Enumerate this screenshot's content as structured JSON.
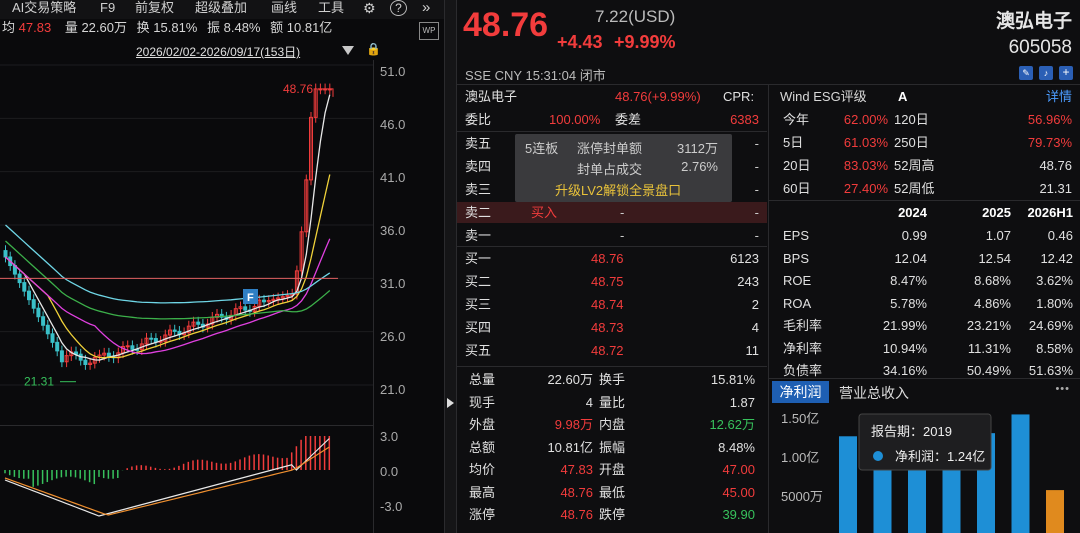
{
  "toolbar": {
    "ai_strategy": "AI交易策略",
    "f9": "F9",
    "adjust": "前复权",
    "overlay": "超级叠加",
    "draw": "画线",
    "tools": "工具",
    "more": "»"
  },
  "stats_bar": {
    "avg_label": "均",
    "avg_value": "47.83",
    "vol_label": "量",
    "vol_value": "22.60万",
    "turn_label": "换",
    "turn_value": "15.81%",
    "amp_label": "振",
    "amp_value": "8.48%",
    "amt_label": "额",
    "amt_value": "10.81亿"
  },
  "range_text": "2026/02/02-2026/09/17(153日)",
  "price_axis": [
    "51.0",
    "46.0",
    "41.0",
    "36.0",
    "31.0",
    "26.0",
    "21.0"
  ],
  "macd_axis": [
    "3.0",
    "0.0",
    "-3.0"
  ],
  "annotations": {
    "high": "48.76",
    "low": "21.31",
    "marker": "F"
  },
  "quote": {
    "price": "48.76",
    "usd": "7.22(USD)",
    "change": "+4.43",
    "pct": "+9.99%",
    "name": "澳弘电子",
    "code": "605058",
    "exch": "SSE",
    "currency": "CNY",
    "time": "15:31:04",
    "status": "闭市"
  },
  "order": {
    "title": "澳弘电子",
    "price": "48.76(+9.99%)",
    "cpr": "CPR:",
    "wb_label": "委比",
    "wb_value": "100.00%",
    "wc_label": "委差",
    "wc_value": "6383"
  },
  "asks": [
    {
      "label": "卖五",
      "price": "",
      "vol": "-"
    },
    {
      "label": "卖四",
      "price": "",
      "vol": "-"
    },
    {
      "label": "卖三",
      "price": "",
      "vol": "-"
    },
    {
      "label": "卖二",
      "price": "-",
      "vol": "-",
      "flag": "买入"
    },
    {
      "label": "卖一",
      "price": "-",
      "vol": "-"
    }
  ],
  "overlay": {
    "l1a": "5连板",
    "l1b": "涨停封单额",
    "l1c": "3112万",
    "l2b": "封单占成交",
    "l2c": "2.76%",
    "cta": "升级LV2解锁全景盘口"
  },
  "bids": [
    {
      "label": "买一",
      "price": "48.76",
      "vol": "6123"
    },
    {
      "label": "买二",
      "price": "48.75",
      "vol": "243"
    },
    {
      "label": "买三",
      "price": "48.74",
      "vol": "2"
    },
    {
      "label": "买四",
      "price": "48.73",
      "vol": "4"
    },
    {
      "label": "买五",
      "price": "48.72",
      "vol": "11"
    }
  ],
  "summary": [
    {
      "l1": "总量",
      "v1": "22.60万",
      "l2": "换手",
      "v2": "15.81%"
    },
    {
      "l1": "现手",
      "v1": "4",
      "l2": "量比",
      "v2": "1.87"
    },
    {
      "l1": "外盘",
      "v1": "9.98万",
      "l2": "内盘",
      "v2": "12.62万"
    },
    {
      "l1": "总额",
      "v1": "10.81亿",
      "l2": "振幅",
      "v2": "8.48%"
    },
    {
      "l1": "均价",
      "v1": "47.83",
      "l2": "开盘",
      "v2": "47.00"
    },
    {
      "l1": "最高",
      "v1": "48.76",
      "l2": "最低",
      "v2": "45.00"
    },
    {
      "l1": "涨停",
      "v1": "48.76",
      "l2": "跌停",
      "v2": "39.90"
    }
  ],
  "esg": {
    "label": "Wind ESG评级",
    "grade": "A",
    "detail": "详情"
  },
  "perf": [
    {
      "l1": "今年",
      "v1": "62.00%",
      "l2": "120日",
      "v2": "56.96%"
    },
    {
      "l1": "5日",
      "v1": "61.03%",
      "l2": "250日",
      "v2": "79.73%"
    },
    {
      "l1": "20日",
      "v1": "83.03%",
      "l2": "52周高",
      "v2": "48.76"
    },
    {
      "l1": "60日",
      "v1": "27.40%",
      "l2": "52周低",
      "v2": "21.31"
    }
  ],
  "fin_years": [
    "2024",
    "2025",
    "2026H1"
  ],
  "fin": [
    {
      "label": "EPS",
      "vals": [
        "0.99",
        "1.07",
        "0.46"
      ]
    },
    {
      "label": "BPS",
      "vals": [
        "12.04",
        "12.54",
        "12.42"
      ]
    },
    {
      "label": "ROE",
      "vals": [
        "8.47%",
        "8.68%",
        "3.62%"
      ]
    },
    {
      "label": "ROA",
      "vals": [
        "5.78%",
        "4.86%",
        "1.80%"
      ]
    },
    {
      "label": "毛利率",
      "vals": [
        "21.99%",
        "23.21%",
        "24.69%"
      ]
    },
    {
      "label": "净利率",
      "vals": [
        "10.94%",
        "11.31%",
        "8.58%"
      ]
    },
    {
      "label": "负债率",
      "vals": [
        "34.16%",
        "50.49%",
        "51.63%"
      ]
    }
  ],
  "tabs": {
    "t1": "净利润",
    "t2": "营业总收入",
    "more": "•••"
  },
  "profit_chart": {
    "yticks": [
      "1.50亿",
      "1.00亿",
      "5000万"
    ],
    "tip_title": "报告期：2019",
    "tip_label": "净利润：1.24亿",
    "bars": [
      1.24,
      1.05,
      1.18,
      1.14,
      1.28,
      1.52,
      0.55
    ]
  },
  "colors": {
    "up": "#f23c3c",
    "down": "#37c15c",
    "ma5": "#e8e8e8",
    "ma10": "#f0d23a",
    "ma20": "#e040e0",
    "ma60": "#3cb04a",
    "ma120": "#6fd6e6",
    "bar": "#1e8fd6",
    "bar_last": "#e08a1e"
  }
}
